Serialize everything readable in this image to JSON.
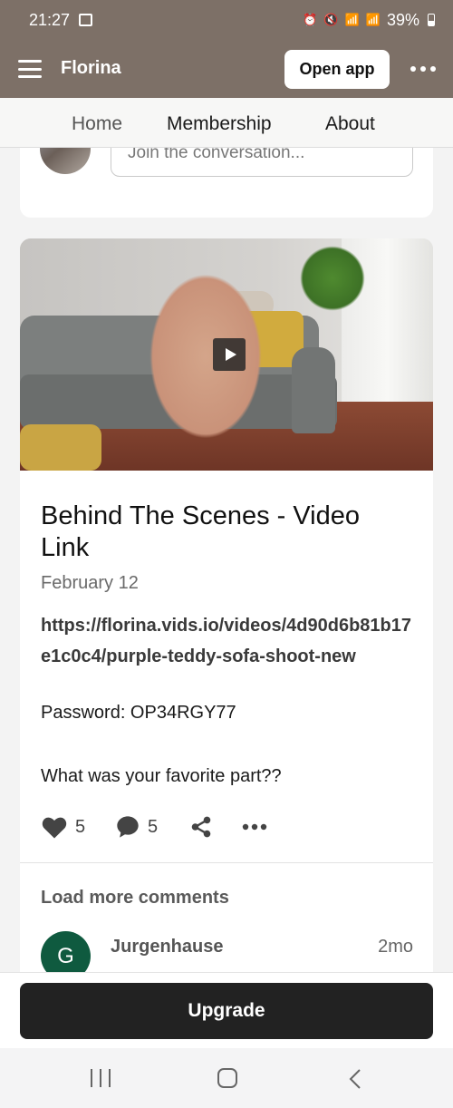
{
  "status_bar": {
    "time": "21:27",
    "battery": "39%",
    "icons": [
      "gallery-icon",
      "alarm-icon",
      "mute-icon",
      "wifi-calling-icon",
      "signal-sim1-icon",
      "signal-sim2-icon",
      "battery-icon"
    ]
  },
  "header": {
    "creator_name": "Florina",
    "open_app_label": "Open app"
  },
  "tabs": [
    {
      "label": "Home"
    },
    {
      "label": "Membership"
    },
    {
      "label": "About"
    }
  ],
  "comment_box": {
    "placeholder": "Join the conversation..."
  },
  "post": {
    "title": "Behind The Scenes - Video Link",
    "date": "February 12",
    "link": "https://florina.vids.io/videos/4d90d6b81b17e1c0c4/purple-teddy-sofa-shoot-new",
    "password": "Password: OP34RGY77",
    "question": "What was your favorite part??",
    "likes": "5",
    "comments": "5"
  },
  "comments": {
    "load_more_label": "Load more comments",
    "items": [
      {
        "avatar_letter": "G",
        "author": "Jurgenhause",
        "time": "2mo",
        "avatar_color": "#0f5a3f"
      }
    ]
  },
  "upgrade": {
    "label": "Upgrade"
  },
  "colors": {
    "header_bg": "#7d7067",
    "button_dark": "#222222"
  }
}
